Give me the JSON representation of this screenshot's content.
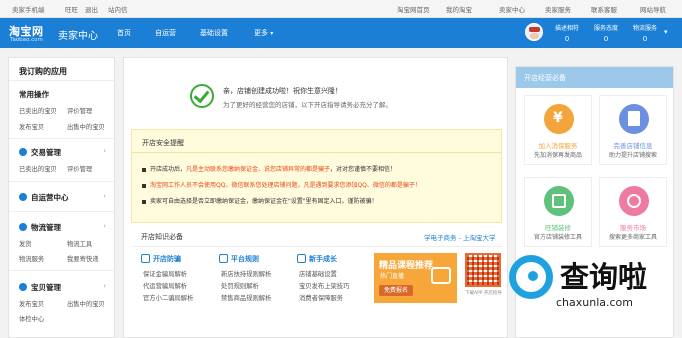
{
  "topbar": {
    "left": [
      "卖家手机端",
      "旺旺",
      "退出",
      "站内信"
    ],
    "right": [
      "淘宝网首页",
      "我的淘宝",
      "卖家中心",
      "卖家服务",
      "联系客服",
      "网站导航"
    ]
  },
  "header": {
    "logo": "淘宝网",
    "logo_sub": "Taobao.com",
    "title": "卖家中心",
    "nav": [
      "首页",
      "自运营",
      "基础设置",
      "更多"
    ],
    "stats": [
      {
        "label": "描述相符",
        "value": "0"
      },
      {
        "label": "服务态度",
        "value": "0"
      },
      {
        "label": "物流服务",
        "value": "0"
      }
    ]
  },
  "sidebar": {
    "title": "我订购的应用",
    "common": {
      "title": "常用操作",
      "links": [
        "已卖出的宝贝",
        "评价管理",
        "发布宝贝",
        "出售中的宝贝"
      ]
    },
    "sections": [
      {
        "title": "交易管理",
        "links": [
          "已卖出的宝贝",
          "评价管理"
        ]
      },
      {
        "title": "自运营中心",
        "links": []
      },
      {
        "title": "物流管理",
        "links": [
          "发货",
          "物流工具",
          "物流服务",
          "我要寄快递"
        ]
      },
      {
        "title": "宝贝管理",
        "links": [
          "发布宝贝",
          "出售中的宝贝",
          "体检中心"
        ]
      }
    ]
  },
  "success": {
    "title": "亲，店铺创建成功啦！祝你生意兴隆！",
    "subtitle": "为了更好的经营您的店铺，以下开店指导请务必充分了解。"
  },
  "notice": {
    "title": "开店安全提醒",
    "lines": [
      {
        "pre": "开店成功后，",
        "red": "凡是主动联系您缴纳保证金、说您店铺异常的都是骗子",
        "post": "，对对您谨慎不要相信！"
      },
      {
        "pre": "淘宝网工作人员不会使用QQ、微信联系您处理店铺问题",
        "red": "，凡是遇到要求您添加QQ、微信的都是骗子！",
        "post": ""
      },
      {
        "pre": "卖家可自由选择是否立即缴纳保证金，缴纳保证金在\"设置\"里有固定入口，谨防被骗！",
        "red": "",
        "post": ""
      }
    ]
  },
  "tools": {
    "title": "开店知识必备",
    "link": "学电子商务 - 上淘宝大学",
    "columns": [
      {
        "title": "开店防骗",
        "items": [
          "保证金骗局解析",
          "代运营骗局解析",
          "官方小二骗局解析"
        ]
      },
      {
        "title": "平台规则",
        "items": [
          "新店扶持规则解析",
          "处罚规则解析",
          "禁售商品规则解析"
        ]
      },
      {
        "title": "新手成长",
        "items": [
          "店铺基础设置",
          "宝贝发布上架技巧",
          "消费者保障服务"
        ]
      }
    ],
    "course": {
      "title": "精品课程推荐",
      "subtitle": "热门直播",
      "button": "免费报名"
    },
    "qr_caption": "下载APP 开店指导"
  },
  "right_panel": {
    "title": "开店经营必备",
    "cards": [
      {
        "title": "加入消保服务",
        "desc": "先加消保再发商品",
        "color": "#f3a43b",
        "icon": "yen-icon"
      },
      {
        "title": "完善店铺信息",
        "desc": "助力提升店铺搜索",
        "color": "#6d8fe0",
        "icon": "document-icon"
      },
      {
        "title": "旺铺装修",
        "desc": "官方店铺装修工具",
        "color": "#5fc17b",
        "icon": "paint-icon"
      },
      {
        "title": "服务市场",
        "desc": "搜索更多商家工具",
        "color": "#ef7aa0",
        "icon": "market-icon"
      }
    ]
  },
  "watermark": {
    "text": "查询啦",
    "domain": "chaxunla.com"
  }
}
